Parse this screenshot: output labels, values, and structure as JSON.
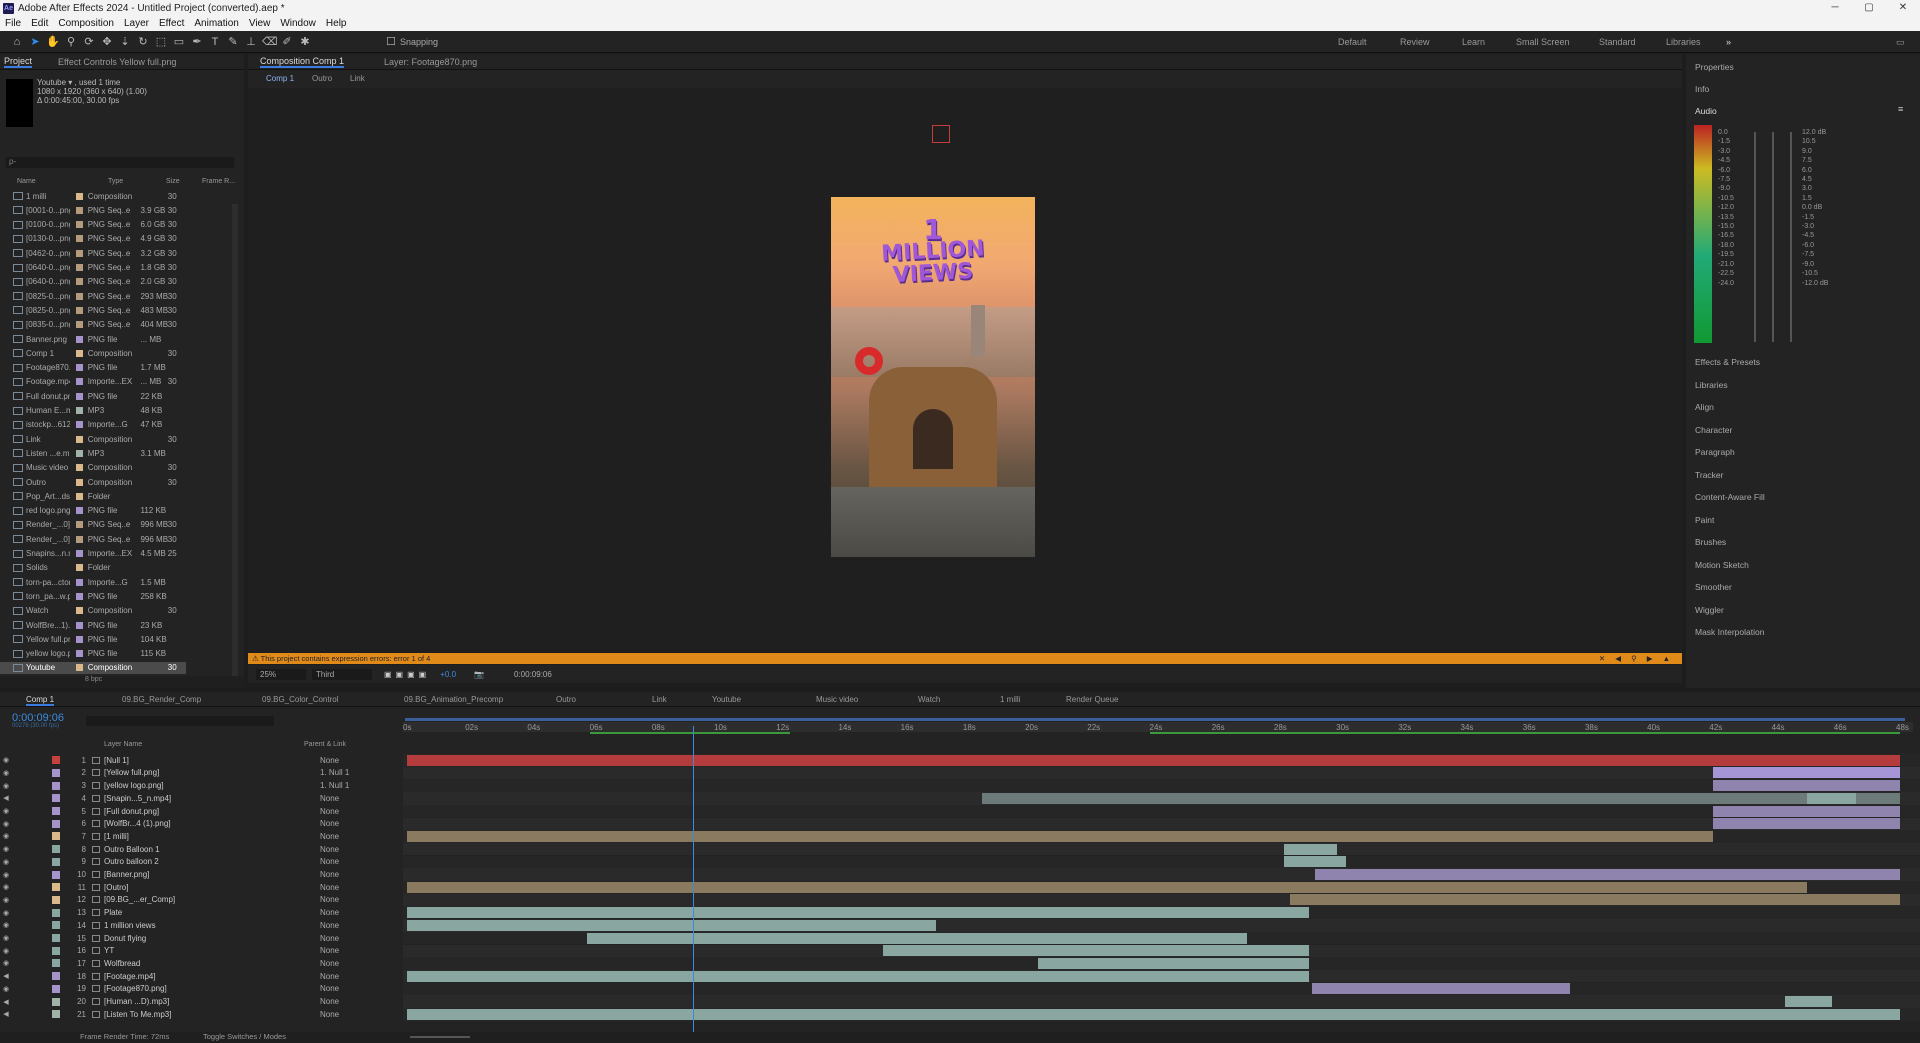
{
  "app": {
    "title": "Adobe After Effects 2024 - Untitled Project (converted).aep *",
    "logo": "Ae",
    "win_controls": [
      "─",
      "▢",
      "✕"
    ]
  },
  "menu": [
    "File",
    "Edit",
    "Composition",
    "Layer",
    "Effect",
    "Animation",
    "View",
    "Window",
    "Help"
  ],
  "toolbar": {
    "snapping": "Snapping",
    "workspaces": [
      "Default",
      "Review",
      "Learn",
      "Small Screen",
      "Standard",
      "Libraries"
    ]
  },
  "project": {
    "tab": "Project",
    "effect_tab": "Effect Controls Yellow full.png",
    "item_name": "Youtube ▾ , used 1 time",
    "item_dims": "1080 x 1920  (360 x 640) (1.00)",
    "item_dur": "Δ 0:00:45:00, 30.00 fps",
    "search_placeholder": "ρ-",
    "columns": [
      "Name",
      "Type",
      "Size",
      "Frame R..."
    ],
    "items": [
      [
        "1 milli",
        "Composition",
        "",
        "30",
        "#d9b98c"
      ],
      [
        "[0001-0...png",
        "PNG Seq..e",
        "3.9 GB",
        "30",
        "#b49b7e"
      ],
      [
        "[0100-0...png",
        "PNG Seq..e",
        "6.0 GB",
        "30",
        "#b49b7e"
      ],
      [
        "[0130-0...png",
        "PNG Seq..e",
        "4.9 GB",
        "30",
        "#b49b7e"
      ],
      [
        "[0462-0...png",
        "PNG Seq..e",
        "3.2 GB",
        "30",
        "#b49b7e"
      ],
      [
        "[0640-0...png",
        "PNG Seq..e",
        "1.8 GB",
        "30",
        "#b49b7e"
      ],
      [
        "[0640-0...png",
        "PNG Seq..e",
        "2.0 GB",
        "30",
        "#b49b7e"
      ],
      [
        "[0825-0...png",
        "PNG Seq..e",
        "293 MB",
        "30",
        "#b49b7e"
      ],
      [
        "[0825-0...png",
        "PNG Seq..e",
        "483 MB",
        "30",
        "#b49b7e"
      ],
      [
        "[0835-0...png",
        "PNG Seq..e",
        "404 MB",
        "30",
        "#b49b7e"
      ],
      [
        "Banner.png",
        "PNG file",
        "... MB",
        "",
        "#a593c9"
      ],
      [
        "Comp 1",
        "Composition",
        "",
        "30",
        "#d9b98c"
      ],
      [
        "Footage870.png",
        "PNG file",
        "1.7 MB",
        "",
        "#a593c9"
      ],
      [
        "Footage.mp4",
        "Importe...EX",
        "... MB",
        "30",
        "#a593c9"
      ],
      [
        "Full donut.png",
        "PNG file",
        "22 KB",
        "",
        "#a593c9"
      ],
      [
        "Human E...mp3",
        "MP3",
        "48 KB",
        "",
        "#9fb3a6"
      ],
      [
        "istockp...612.jpg",
        "Importe...G",
        "47 KB",
        "",
        "#a593c9"
      ],
      [
        "Link",
        "Composition",
        "",
        "30",
        "#d9b98c"
      ],
      [
        "Listen ...e.mp3",
        "MP3",
        "3.1 MB",
        "",
        "#9fb3a6"
      ],
      [
        "Music video",
        "Composition",
        "",
        "30",
        "#d9b98c"
      ],
      [
        "Outro",
        "Composition",
        "",
        "30",
        "#d9b98c"
      ],
      [
        "Pop_Art...ds.aep",
        "Folder",
        "",
        "",
        "#d9b98c"
      ],
      [
        "red logo.png",
        "PNG file",
        "112 KB",
        "",
        "#a593c9"
      ],
      [
        "Render_...0].png",
        "PNG Seq..e",
        "996 MB",
        "30",
        "#b49b7e"
      ],
      [
        "Render_...0].png",
        "PNG Seq..e",
        "996 MB",
        "30",
        "#b49b7e"
      ],
      [
        "Snapins...n.mp4",
        "Importe...EX",
        "4.5 MB",
        "25",
        "#a593c9"
      ],
      [
        "Solids",
        "Folder",
        "",
        "",
        "#d9b98c"
      ],
      [
        "torn-pa...ctor.jpg",
        "Importe...G",
        "1.5 MB",
        "",
        "#a593c9"
      ],
      [
        "torn_pa...w.png",
        "PNG file",
        "258 KB",
        "",
        "#a593c9"
      ],
      [
        "Watch",
        "Composition",
        "",
        "30",
        "#d9b98c"
      ],
      [
        "WolfBre...1).png",
        "PNG file",
        "23 KB",
        "",
        "#a593c9"
      ],
      [
        "Yellow full.png",
        "PNG file",
        "104 KB",
        "",
        "#a593c9"
      ],
      [
        "yellow logo.png",
        "PNG file",
        "115 KB",
        "",
        "#a593c9"
      ],
      [
        "Youtube",
        "Composition",
        "",
        "30",
        "#d9b98c"
      ]
    ],
    "footer": "8 bpc"
  },
  "comp": {
    "tab": "Composition Comp 1",
    "layer_tab": "Layer: Footage870.png",
    "crumbs": [
      "Comp 1",
      "Outro",
      "Link"
    ],
    "warning": "This project contains expression errors: error 1 of 4",
    "zoom": "25%",
    "res": "Third",
    "exposure": "+0.0",
    "timecode": "0:00:09:06",
    "text1": "1",
    "text2": "MILLION",
    "text3": "VIEWS"
  },
  "right": {
    "items": [
      "Properties",
      "Info",
      "Audio",
      "Effects & Presets",
      "Libraries",
      "Align",
      "Character",
      "Paragraph",
      "Tracker",
      "Content-Aware Fill",
      "Paint",
      "Brushes",
      "Motion Sketch",
      "Smoother",
      "Wiggler",
      "Mask Interpolation"
    ],
    "audio_left": [
      "0.0",
      "-1.5",
      "-3.0",
      "-4.5",
      "-6.0",
      "-7.5",
      "-9.0",
      "-10.5",
      "-12.0",
      "-13.5",
      "-15.0",
      "-16.5",
      "-18.0",
      "-19.5",
      "-21.0",
      "-22.5",
      "-24.0"
    ],
    "audio_right": [
      "12.0 dB",
      "10.5",
      "9.0",
      "7.5",
      "6.0",
      "4.5",
      "3.0",
      "1.5",
      "0.0 dB",
      "-1.5",
      "-3.0",
      "-4.5",
      "-6.0",
      "-7.5",
      "-9.0",
      "-10.5",
      "-12.0 dB"
    ]
  },
  "timeline": {
    "tabs": [
      "Comp 1",
      "09.BG_Render_Comp",
      "09.BG_Color_Control",
      "09.BG_Animation_Precomp",
      "Outro",
      "Link",
      "Youtube",
      "Music video",
      "Watch",
      "1 milli",
      "Render Queue"
    ],
    "timecode": "0:00:09:06",
    "sub_tc": "00276 (30.00 fps)",
    "col_layer": "Layer Name",
    "col_parent": "Parent & Link",
    "ruler": [
      "0s",
      "02s",
      "04s",
      "06s",
      "08s",
      "10s",
      "12s",
      "14s",
      "16s",
      "18s",
      "20s",
      "22s",
      "24s",
      "26s",
      "28s",
      "30s",
      "32s",
      "34s",
      "36s",
      "38s",
      "40s",
      "42s",
      "44s",
      "46s",
      "48s"
    ],
    "playhead_s": 9.2,
    "duration_s": 48,
    "layers": [
      [
        "1",
        "[Null 1]",
        "None",
        "#c9413c",
        [
          [
            0,
            48,
            "#b43c3c"
          ]
        ]
      ],
      [
        "2",
        "[Yellow full.png]",
        "1. Null 1",
        "#a593c9",
        [
          [
            42,
            48,
            "#a595d6"
          ]
        ]
      ],
      [
        "3",
        "[yellow logo.png]",
        "1. Null 1",
        "#a593c9",
        [
          [
            42,
            48,
            "#8f84ad"
          ]
        ]
      ],
      [
        "4",
        "[Snapin...5_n.mp4]",
        "None",
        "#a593c9",
        [
          [
            18.5,
            48,
            "#6d7a7a"
          ],
          [
            45,
            46.6,
            "#8aa6a0"
          ]
        ]
      ],
      [
        "5",
        "[Full donut.png]",
        "None",
        "#a593c9",
        [
          [
            42,
            48,
            "#8f84ad"
          ]
        ]
      ],
      [
        "6",
        "[WolfBr...4 (1).png]",
        "None",
        "#a593c9",
        [
          [
            42,
            48,
            "#8f84ad"
          ]
        ]
      ],
      [
        "7",
        "[1 milli]",
        "None",
        "#d9b98c",
        [
          [
            0,
            42,
            "#8a7a60"
          ]
        ]
      ],
      [
        "8",
        "Outro Balloon 1",
        "None",
        "#8aa6a0",
        [
          [
            28.2,
            29.9,
            "#8aa6a0"
          ]
        ]
      ],
      [
        "9",
        "Outro balloon 2",
        "None",
        "#8aa6a0",
        [
          [
            28.2,
            30.2,
            "#8aa6a0"
          ]
        ]
      ],
      [
        "10",
        "[Banner.png]",
        "None",
        "#a593c9",
        [
          [
            29.2,
            48,
            "#8f84ad"
          ]
        ]
      ],
      [
        "11",
        "[Outro]",
        "None",
        "#d9b98c",
        [
          [
            0,
            45,
            "#8a7a60"
          ]
        ]
      ],
      [
        "12",
        "[09.BG_...er_Comp]",
        "None",
        "#d9b98c",
        [
          [
            28.4,
            48,
            "#8a7a60"
          ]
        ]
      ],
      [
        "13",
        "Plate",
        "None",
        "#8aa6a0",
        [
          [
            0,
            29,
            "#8aa6a0"
          ]
        ]
      ],
      [
        "14",
        "1 million views",
        "None",
        "#8aa6a0",
        [
          [
            0,
            17,
            "#8aa6a0"
          ]
        ]
      ],
      [
        "15",
        "Donut flying",
        "None",
        "#8aa6a0",
        [
          [
            5.8,
            27,
            "#8aa6a0"
          ]
        ]
      ],
      [
        "16",
        "YT",
        "None",
        "#8aa6a0",
        [
          [
            15.3,
            29,
            "#8aa6a0"
          ]
        ]
      ],
      [
        "17",
        "Wolfbread",
        "None",
        "#8aa6a0",
        [
          [
            20.3,
            29,
            "#8aa6a0"
          ]
        ]
      ],
      [
        "18",
        "[Footage.mp4]",
        "None",
        "#a593c9",
        [
          [
            0,
            29,
            "#8aa6a0"
          ]
        ]
      ],
      [
        "19",
        "[Footage870.png]",
        "None",
        "#a593c9",
        [
          [
            29.1,
            37.4,
            "#8f84ad"
          ]
        ]
      ],
      [
        "20",
        "[Human ...D).mp3]",
        "None",
        "#9fb3a6",
        [
          [
            44.3,
            45.8,
            "#8aa6a0"
          ]
        ]
      ],
      [
        "21",
        "[Listen To Me.mp3]",
        "None",
        "#9fb3a6",
        [
          [
            0,
            48,
            "#8aa6a0"
          ]
        ]
      ]
    ],
    "footer_render": "Frame Render Time: 72ms",
    "footer_toggle": "Toggle Switches / Modes"
  }
}
